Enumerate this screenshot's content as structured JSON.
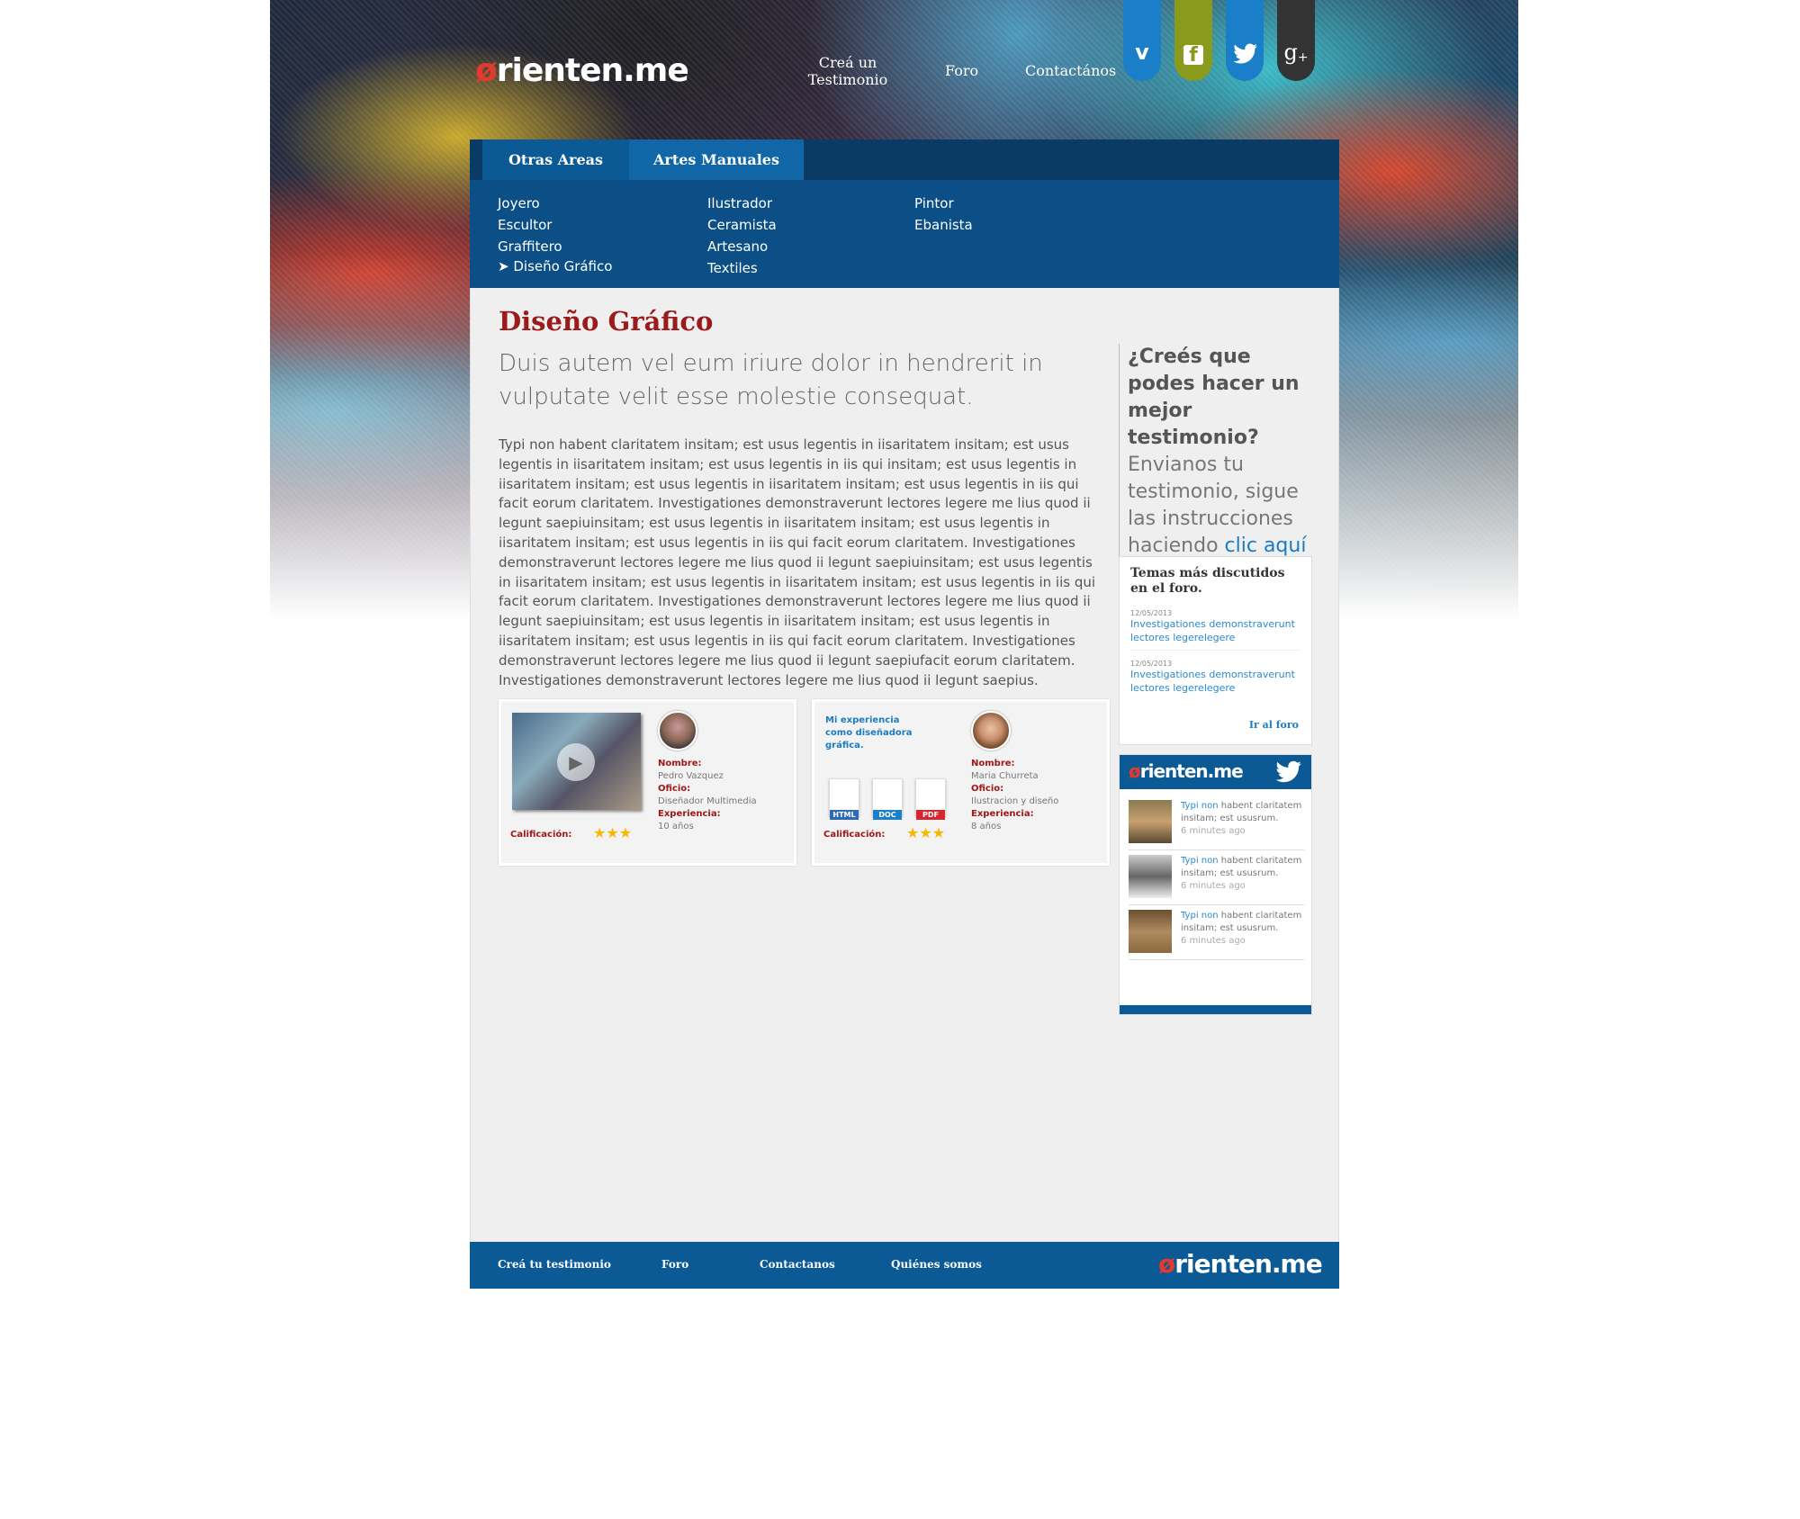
{
  "brand": {
    "logo_o": "ø",
    "logo_rest": "rienten.me"
  },
  "nav": [
    {
      "label": "Creá un Testimonio"
    },
    {
      "label": "Foro"
    },
    {
      "label": "Contactános"
    }
  ],
  "social": [
    {
      "icon": "vimeo-icon",
      "glyph": "v",
      "color": "#1a7fc8"
    },
    {
      "icon": "facebook-icon",
      "glyph": "f",
      "color": "#8a9a1c"
    },
    {
      "icon": "twitter-icon",
      "glyph": "🐦",
      "color": "#1a7fc8"
    },
    {
      "icon": "google-plus-icon",
      "glyph": "g+",
      "color": "#333"
    }
  ],
  "tabs": [
    {
      "label": "Otras Areas"
    },
    {
      "label": "Artes Manuales"
    }
  ],
  "submenu": {
    "col1": [
      "Joyero",
      "Escultor",
      "Graffitero",
      "Diseño Gráfico"
    ],
    "col2": [
      "Ilustrador",
      "Ceramista",
      "Artesano",
      "Textiles"
    ],
    "col3": [
      "Pintor",
      "Ebanista"
    ],
    "active_marker": "➤"
  },
  "main": {
    "title": "Diseño Gráfico",
    "lead": "Duis autem vel eum iriure dolor in hendrerit in vulputate velit esse molestie consequat.",
    "body": "Typi non habent claritatem insitam; est usus legentis in iisaritatem insitam; est usus legentis in iisaritatem insitam; est usus legentis in iis qui insitam; est usus legentis in iisaritatem insitam; est usus legentis in iisaritatem insitam; est usus legentis in iis qui facit eorum claritatem. Investigationes demonstraverunt lectores legere me lius quod ii legunt saepiuinsitam; est usus legentis in iisaritatem insitam; est usus legentis in iisaritatem insitam; est usus legentis in iis qui facit eorum claritatem. Investigationes demonstraverunt lectores legere me lius quod ii legunt saepiuinsitam; est usus legentis in iisaritatem insitam; est usus legentis in iisaritatem insitam; est usus legentis in iis qui facit eorum claritatem. Investigationes demonstraverunt lectores legere me lius quod ii legunt saepiuinsitam; est usus legentis in iisaritatem insitam; est usus legentis in iisaritatem insitam; est usus legentis in iis qui facit eorum claritatem. Investigationes demonstraverunt lectores legere me lius quod ii legunt saepiufacit eorum claritatem. Investigationes demonstraverunt lectores legere me lius quod ii legunt saepius."
  },
  "cards": [
    {
      "name_label": "Nombre:",
      "name": "Pedro Vazquez",
      "job_label": "Oficio:",
      "job": "Diseñador Multimedia",
      "exp_label": "Experiencia:",
      "exp": "10 años",
      "rating_label": "Calificación:",
      "stars": "★★★",
      "rating": 3
    },
    {
      "intro": "Mi experiencia como diseñadora gráfica.",
      "docs": [
        "HTML",
        "DOC",
        "PDF"
      ],
      "doc_colors": [
        "#2d6bb5",
        "#1a7fc8",
        "#d9262c"
      ],
      "name_label": "Nombre:",
      "name": "Maria Churreta",
      "job_label": "Oficio:",
      "job": "Ilustracion y diseño",
      "exp_label": "Experiencia:",
      "exp": "8 años",
      "rating_label": "Calificación:",
      "stars": "★★★",
      "rating": 3
    }
  ],
  "cta": {
    "q": "¿Creés que podes hacer un mejor testimonio?",
    "text": "Envianos tu testimonio, sigue las instrucciones haciendo ",
    "link": "clic aquí"
  },
  "forum": {
    "title": "Temas más discutidos en el foro.",
    "items": [
      {
        "date": "12/05/2013",
        "text": "Investigationes demonstraverunt lectores legerelegere"
      },
      {
        "date": "12/05/2013",
        "text": "Investigationes demonstraverunt lectores legerelegere"
      }
    ],
    "more": "Ir al foro"
  },
  "twitter": {
    "items": [
      {
        "name": "Typi non",
        "text": "habent claritatem insitam; est ususrum.",
        "ago": "6 minutes ago"
      },
      {
        "name": "Typi non",
        "text": "habent claritatem insitam; est ususrum.",
        "ago": "6 minutes ago"
      },
      {
        "name": "Typi non",
        "text": "habent claritatem insitam; est ususrum.",
        "ago": "6 minutes ago"
      }
    ]
  },
  "footer": [
    {
      "label": "Creá tu testimonio"
    },
    {
      "label": "Foro"
    },
    {
      "label": "Contactanos"
    },
    {
      "label": "Quiénes somos"
    }
  ]
}
